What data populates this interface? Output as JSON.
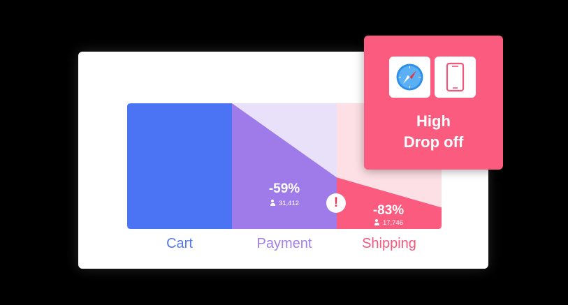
{
  "chart_data": {
    "type": "area",
    "title": "",
    "categories": [
      "Cart",
      "Payment",
      "Shipping"
    ],
    "stages": [
      {
        "name": "Cart",
        "retained_pct": 100
      },
      {
        "name": "Payment",
        "retained_pct": 41,
        "change": "-59%",
        "users": "31,412"
      },
      {
        "name": "Shipping",
        "retained_pct": 17,
        "change": "-83%",
        "users": "17,746"
      }
    ],
    "colors": {
      "cart": "#4b74f5",
      "payment": "#9f7ae9",
      "payment_bg": "#e9e1fa",
      "shipping": "#fb5b7e",
      "shipping_bg": "#fde0e6",
      "cart_label": "#5479e8",
      "payment_label": "#a27ee8",
      "shipping_label": "#f5587c"
    }
  },
  "alert": {
    "glyph": "!",
    "icon": "exclamation-icon"
  },
  "popup": {
    "line1": "High",
    "line2": "Drop off",
    "icons": [
      "safari-compass-icon",
      "mobile-phone-icon"
    ],
    "accent": "#fb5b7e"
  }
}
